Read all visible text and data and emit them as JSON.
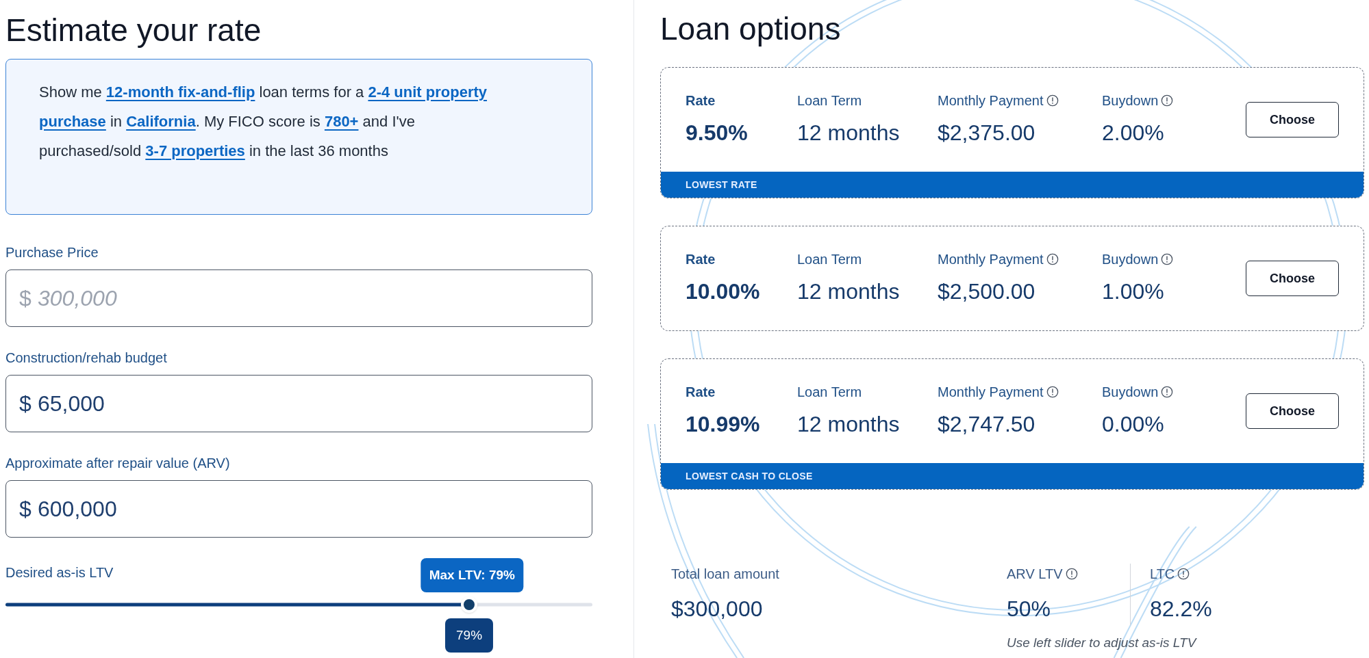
{
  "left": {
    "title": "Estimate your rate",
    "summary": [
      {
        "kind": "text",
        "text": "Show me "
      },
      {
        "kind": "link",
        "text": "12-month fix-and-flip"
      },
      {
        "kind": "text",
        "text": " loan terms for a "
      },
      {
        "kind": "link",
        "text": "2-4 unit property"
      },
      {
        "kind": "link",
        "text": "purchase"
      },
      {
        "kind": "text",
        "text": " in "
      },
      {
        "kind": "link",
        "text": "California"
      },
      {
        "kind": "text",
        "text": ". My FICO score is "
      },
      {
        "kind": "link",
        "text": "780+"
      },
      {
        "kind": "text",
        "text": " and I've purchased/sold "
      },
      {
        "kind": "link",
        "text": "3-7 properties"
      },
      {
        "kind": "text",
        "text": " in the last 36 months"
      }
    ],
    "fields": [
      {
        "label": "Purchase Price",
        "prefix": "$",
        "placeholder": "300,000"
      },
      {
        "label": "Construction/rehab budget",
        "prefix": "$",
        "value": "65,000"
      },
      {
        "label": "Approximate after repair value (ARV)",
        "prefix": "$",
        "value": "600,000"
      }
    ],
    "slider": {
      "label": "Desired as-is LTV",
      "level": 0.79,
      "max_label": "Max LTV: 79%",
      "reading": "79%"
    }
  },
  "right": {
    "title": "Loan options",
    "options": [
      {
        "columns": [
          {
            "label": "Rate",
            "value": "9.50%",
            "info": false
          },
          {
            "label": "Loan Term",
            "value": "12 months",
            "info": false
          },
          {
            "label": "Monthly Payment",
            "value": "$2,375.00",
            "info": true
          },
          {
            "label": "Buydown",
            "value": "2.00%",
            "info": true
          }
        ],
        "button": "Choose",
        "tag": "LOWEST RATE"
      },
      {
        "columns": [
          {
            "label": "Rate",
            "value": "10.00%",
            "info": false
          },
          {
            "label": "Loan Term",
            "value": "12 months",
            "info": false
          },
          {
            "label": "Monthly Payment",
            "value": "$2,500.00",
            "info": true
          },
          {
            "label": "Buydown",
            "value": "1.00%",
            "info": true
          }
        ],
        "button": "Choose"
      },
      {
        "columns": [
          {
            "label": "Rate",
            "value": "10.99%",
            "info": false
          },
          {
            "label": "Loan Term",
            "value": "12 months",
            "info": false
          },
          {
            "label": "Monthly Payment",
            "value": "$2,747.50",
            "info": true
          },
          {
            "label": "Buydown",
            "value": "0.00%",
            "info": true
          }
        ],
        "button": "Choose",
        "tag": "LOWEST CASH TO CLOSE"
      }
    ],
    "summary": {
      "total_label": "Total loan amount",
      "total_value": "$300,000",
      "metrics": [
        {
          "label": "ARV LTV",
          "value": "50%"
        },
        {
          "label": "LTC",
          "value": "82.2%"
        }
      ],
      "note": "Use left slider to adjust as-is LTV"
    }
  }
}
